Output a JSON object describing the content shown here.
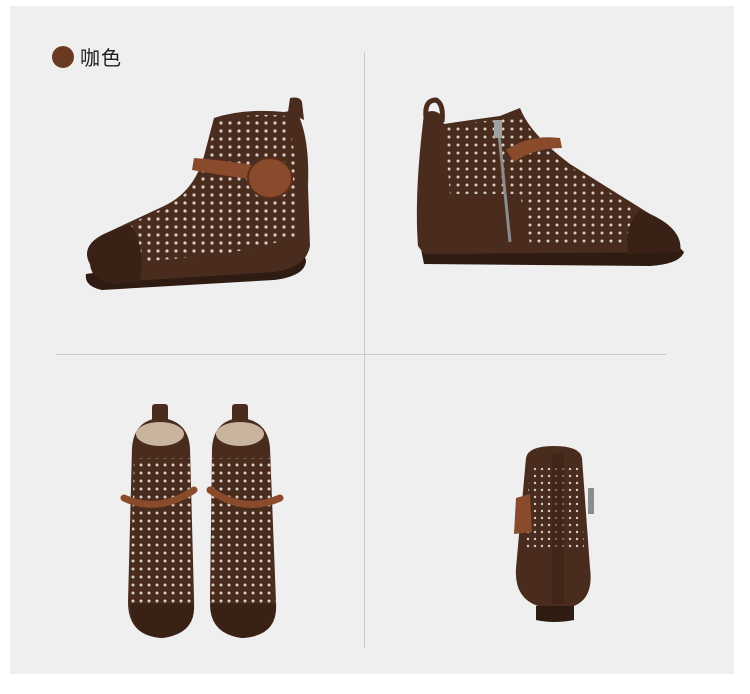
{
  "header": {
    "color_name": "咖色",
    "swatch_color": "#6b3a22"
  },
  "colors": {
    "leather": "#4a2c1f",
    "leather_dark": "#2e1b12",
    "toe_cap": "#3a2116",
    "strap": "#8a4a2c",
    "sole": "#3b2a22",
    "lining": "#c8b39f",
    "perforation": "#f2ebe3",
    "background": "#efefef",
    "divider": "#c9c9c9"
  },
  "views": [
    "side-view-outer",
    "side-view-inner",
    "front-pair-view",
    "back-view"
  ]
}
